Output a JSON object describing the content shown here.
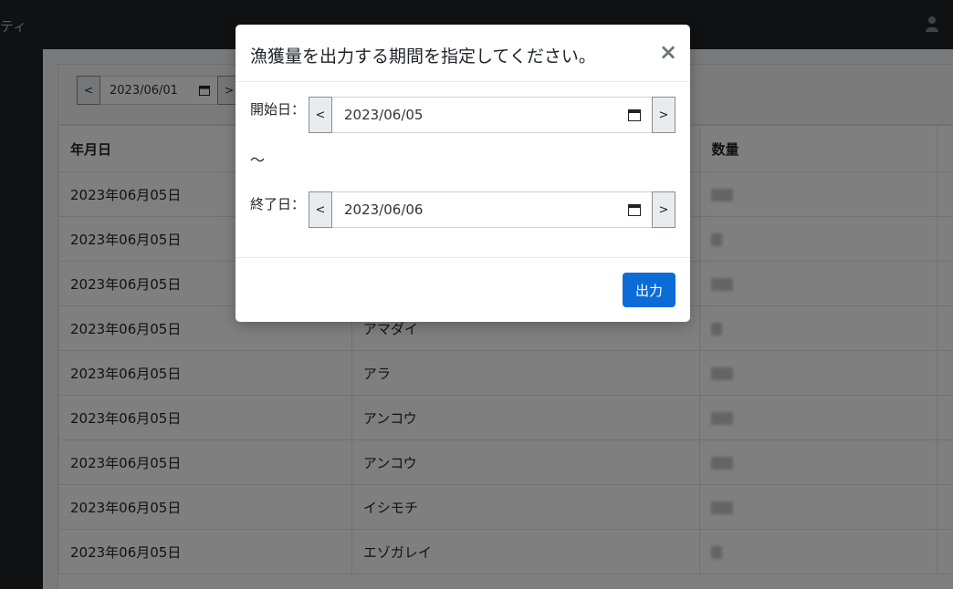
{
  "app": {
    "title_fragment": "ティ"
  },
  "filter": {
    "date": "2023/06/01",
    "prev_label": "<",
    "next_label": ">"
  },
  "table": {
    "headers": {
      "date": "年月日",
      "quantity": "数量"
    },
    "rows": [
      {
        "date": "2023年06月05日",
        "name": ""
      },
      {
        "date": "2023年06月05日",
        "name": ""
      },
      {
        "date": "2023年06月05日",
        "name": ""
      },
      {
        "date": "2023年06月05日",
        "name": "アマダイ"
      },
      {
        "date": "2023年06月05日",
        "name": "アラ"
      },
      {
        "date": "2023年06月05日",
        "name": "アンコウ"
      },
      {
        "date": "2023年06月05日",
        "name": "アンコウ"
      },
      {
        "date": "2023年06月05日",
        "name": "イシモチ"
      },
      {
        "date": "2023年06月05日",
        "name": "エゾガレイ"
      }
    ]
  },
  "modal": {
    "title": "漁獲量を出力する期間を指定してください。",
    "close_label": "×",
    "start": {
      "label": "開始日：",
      "value": "2023/06/05",
      "prev_label": "<",
      "next_label": ">"
    },
    "separator": "～",
    "end": {
      "label": "終了日：",
      "value": "2023/06/06",
      "prev_label": "<",
      "next_label": ">"
    },
    "submit_label": "出力"
  },
  "colors": {
    "primary": "#0b6bd7",
    "topbar": "#1f2327",
    "overlay": "rgba(0,0,0,0.5)"
  }
}
